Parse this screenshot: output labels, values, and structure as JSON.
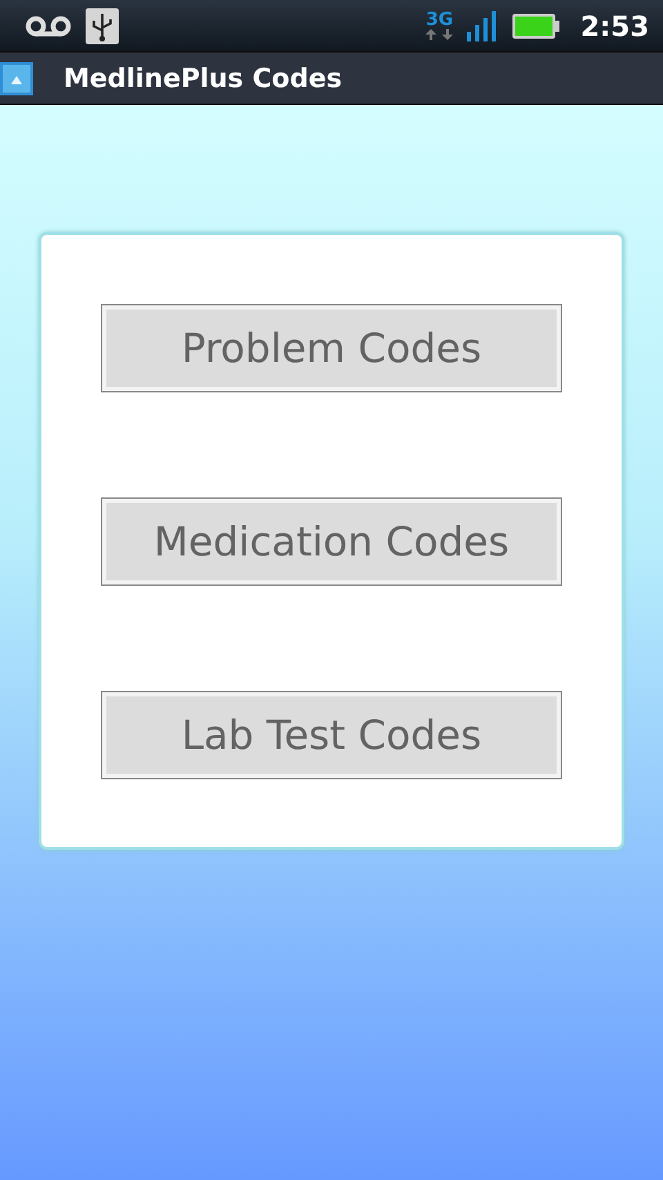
{
  "status_bar": {
    "network_type": "3G",
    "time": "2:53"
  },
  "title_bar": {
    "title": "MedlinePlus Codes"
  },
  "buttons": [
    {
      "label": "Problem Codes"
    },
    {
      "label": "Medication Codes"
    },
    {
      "label": "Lab Test Codes"
    }
  ]
}
